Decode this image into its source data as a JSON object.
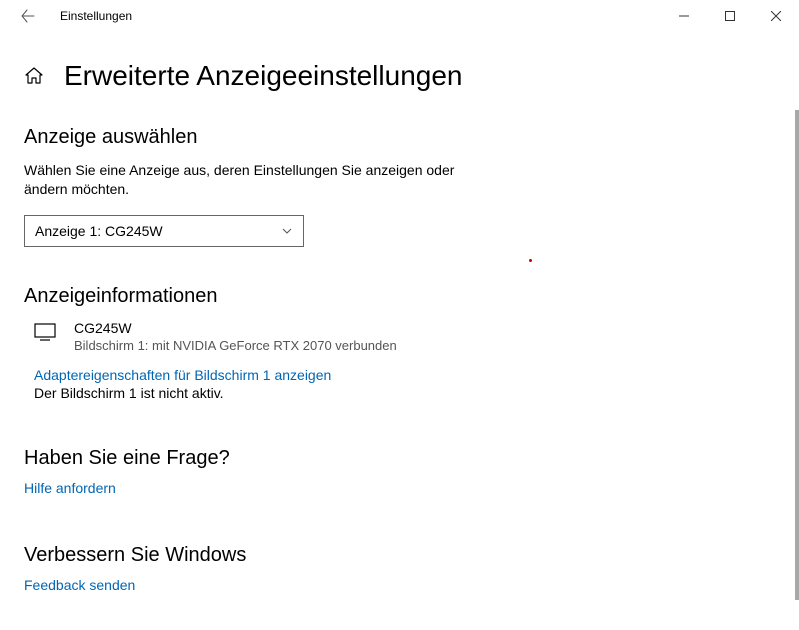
{
  "titlebar": {
    "title": "Einstellungen"
  },
  "header": {
    "pageTitle": "Erweiterte Anzeigeeinstellungen"
  },
  "selectDisplay": {
    "title": "Anzeige auswählen",
    "description": "Wählen Sie eine Anzeige aus, deren Einstellungen Sie anzeigen oder ändern möchten.",
    "dropdownValue": "Anzeige 1: CG245W"
  },
  "displayInfo": {
    "title": "Anzeigeinformationen",
    "displayName": "CG245W",
    "connection": "Bildschirm 1: mit NVIDIA GeForce RTX 2070 verbunden",
    "adapterLink": "Adaptereigenschaften für Bildschirm 1 anzeigen",
    "status": "Der Bildschirm 1 ist nicht aktiv."
  },
  "question": {
    "title": "Haben Sie eine Frage?",
    "helpLink": "Hilfe anfordern"
  },
  "improve": {
    "title": "Verbessern Sie Windows",
    "feedbackLink": "Feedback senden"
  }
}
